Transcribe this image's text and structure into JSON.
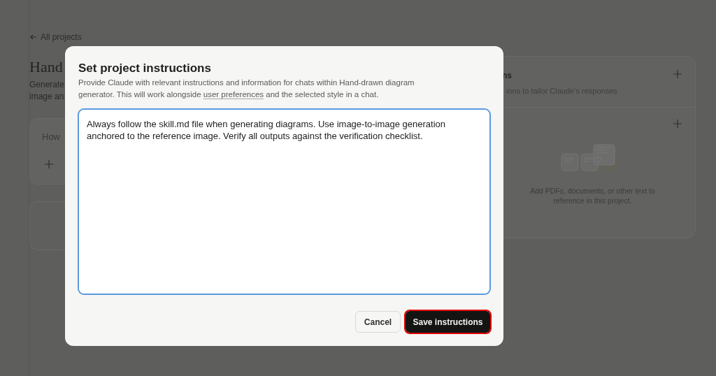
{
  "page": {
    "back_link": "All projects",
    "heading": "Hand",
    "description_lines": [
      "Generate",
      "image an"
    ],
    "prompt_card": {
      "text": "How"
    },
    "instructions_panel": {
      "title": "ns",
      "subtitle": "ions to tailor Claude’s responses"
    },
    "files_panel": {
      "empty_text": "Add PDFs, documents, or other text to reference in this project."
    }
  },
  "modal": {
    "title": "Set project instructions",
    "description_before": "Provide Claude with relevant instructions and information for chats within Hand-drawn diagram generator. This will work alongside",
    "description_link": "user preferences",
    "description_after": "and the selected style in a chat.",
    "textarea": {
      "value": "Always follow the skill.md file when generating diagrams. Use image-to-image generation anchored to the reference image. Verify all outputs against the verification checklist.",
      "focused": true
    },
    "buttons": [
      {
        "label": "Cancel",
        "kind": "secondary",
        "highlighted": false
      },
      {
        "label": "Save instructions",
        "kind": "primary",
        "highlighted": true
      }
    ]
  }
}
